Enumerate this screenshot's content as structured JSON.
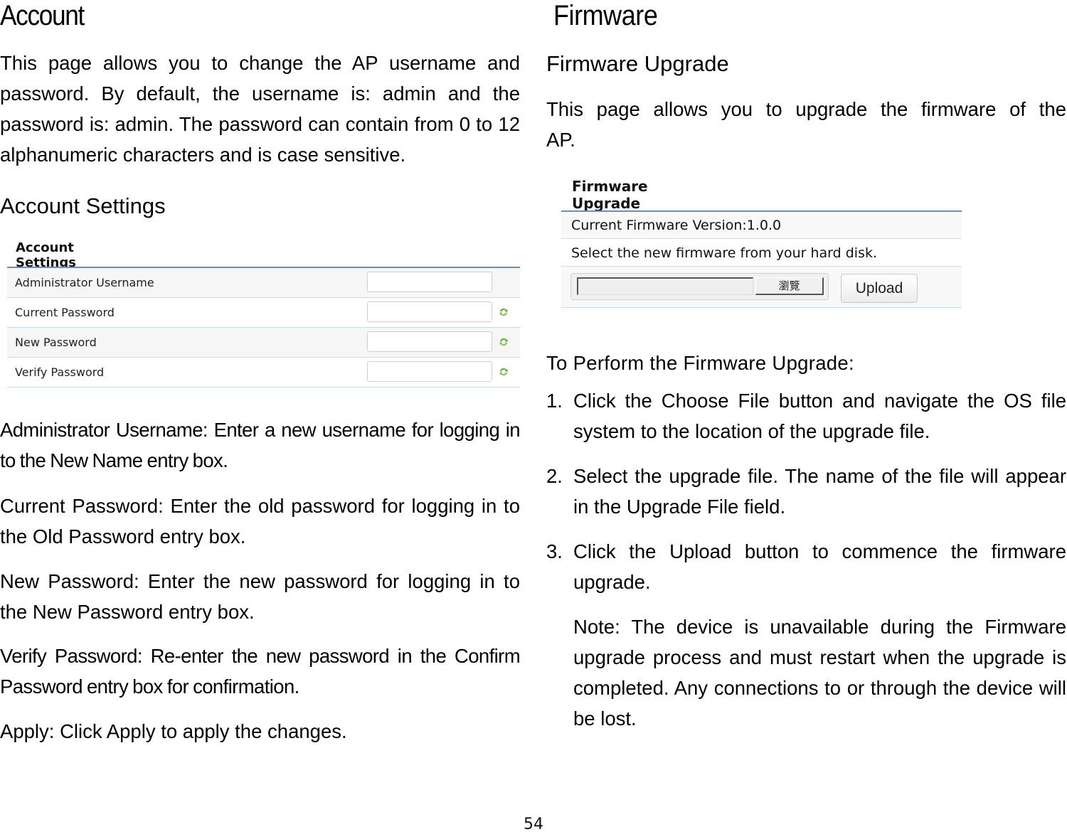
{
  "page_number": "54",
  "account": {
    "heading": "Account",
    "intro": "This page allows you to change the AP username and password. By default, the username is: admin and the password is: admin. The password can contain from 0 to 12 alphanumeric characters and is case sensitive.",
    "subheading": "Account Settings",
    "panel": {
      "title": "Account Settings",
      "rows": [
        {
          "label": "Administrator Username",
          "value": "",
          "has_refresh_icon": false
        },
        {
          "label": "Current Password",
          "value": "",
          "has_refresh_icon": true
        },
        {
          "label": "New Password",
          "value": "",
          "has_refresh_icon": true
        },
        {
          "label": "Verify Password",
          "value": "",
          "has_refresh_icon": true
        }
      ],
      "refresh_icon": "refresh-icon",
      "accent_color": "#6a8cbf",
      "icon_color": "#5fae3c"
    },
    "descriptions": [
      "Administrator Username: Enter a new username for logging in to the New Name entry box.",
      "Current Password: Enter the old password for logging in to the Old Password entry box.",
      "New Password: Enter the new password for logging in to the New Password entry box.",
      "Verify Password: Re-enter the new password in the Confirm Password entry box for confirmation.",
      "Apply: Click Apply to apply the changes."
    ]
  },
  "firmware": {
    "heading": "Firmware",
    "subheading": "Firmware Upgrade",
    "intro": "This page allows you to upgrade the firmware of the AP.",
    "panel": {
      "title": "Firmware Upgrade",
      "current_version_label": "Current Firmware Version:1.0.0",
      "instruction": "Select the new firmware from your hard disk.",
      "file_path_value": "",
      "browse_label": "瀏覽",
      "upload_label": "Upload"
    },
    "steps_heading": "To Perform the Firmware Upgrade:",
    "steps": [
      {
        "num": "1.",
        "text": "Click the Choose File button and navigate the OS file system to the location of the upgrade file."
      },
      {
        "num": "2.",
        "text": "Select the upgrade file. The name of the file will appear in the Upgrade File field."
      },
      {
        "num": "3.",
        "text": "Click the Upload button to commence the firmware upgrade."
      }
    ],
    "note": "Note: The device is unavailable during the Firmware upgrade process and must restart when the upgrade is completed. Any connections to or through the device will be lost."
  }
}
